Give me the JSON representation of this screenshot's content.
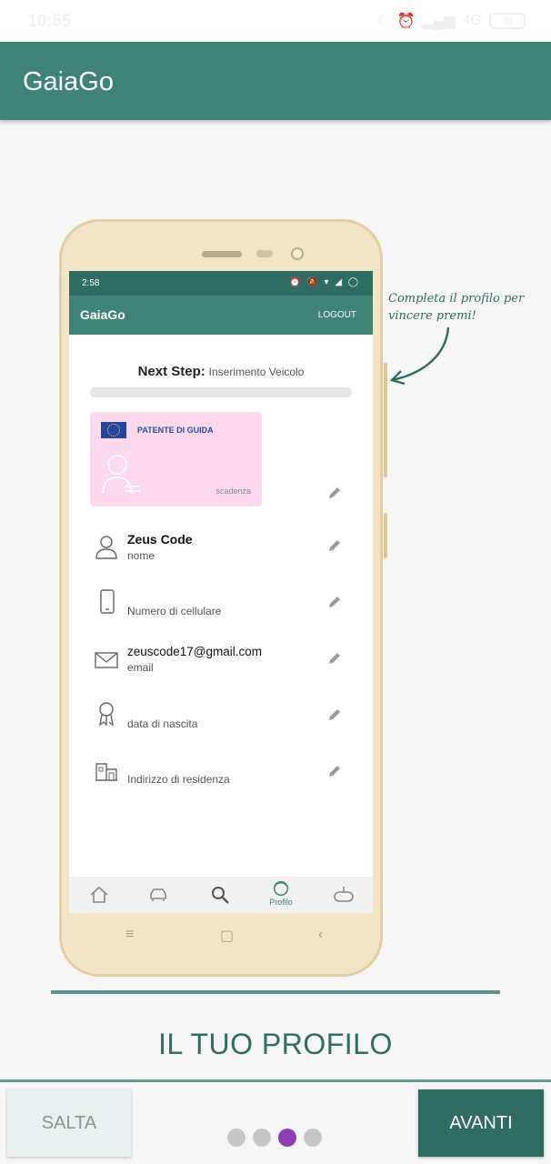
{
  "status_bar": {
    "time": "10:55",
    "network": "4G",
    "battery": "39"
  },
  "app_bar": {
    "title": "GaiaGo"
  },
  "mockup": {
    "status_time": "2:58",
    "status_icons": "⏰ 🔕 ▾ ◢ ◯",
    "app_title": "GaiaGo",
    "logout": "LOGOUT",
    "next_step_label": "Next Step:",
    "next_step_value": "Inserimento Veicolo",
    "license": {
      "title": "PATENTE DI GUIDA",
      "expiry": "scadenza"
    },
    "rows": [
      {
        "value": "Zeus Code",
        "label": "nome"
      },
      {
        "value": "",
        "label": "Numero di cellulare"
      },
      {
        "value": "zeuscode17@gmail.com",
        "label": "email"
      },
      {
        "value": "",
        "label": "data di nascita"
      },
      {
        "value": "",
        "label": "Indirizzo di residenza"
      }
    ],
    "nav": {
      "profile_label": "Profilo"
    }
  },
  "annotation": "Completa il profilo per vincere premi!",
  "section_title": "IL TUO PROFILO",
  "buttons": {
    "skip": "SALTA",
    "next": "AVANTI"
  },
  "pager": {
    "count": 4,
    "active_index": 2
  },
  "colors": {
    "primary": "#3f8378",
    "primary_dark": "#2f6c62",
    "accent_dot": "#8e3fb5",
    "license_pink": "#fcd9ec"
  }
}
